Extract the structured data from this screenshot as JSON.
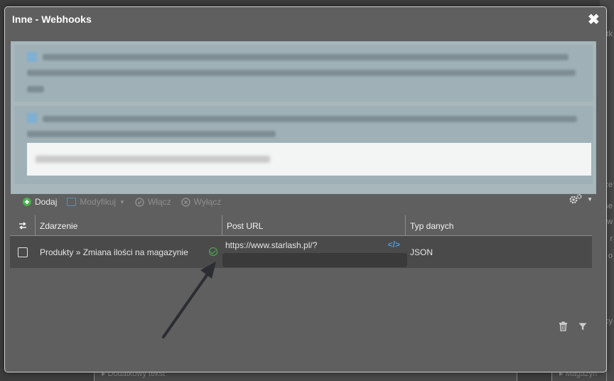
{
  "modal": {
    "title": "Inne - Webhooks"
  },
  "toolbar": {
    "add_label": "Dodaj",
    "modify_label": "Modyfikuj",
    "enable_label": "Włącz",
    "disable_label": "Wyłącz"
  },
  "table": {
    "headers": {
      "event": "Zdarzenie",
      "post_url": "Post URL",
      "data_type": "Typ danych"
    },
    "rows": [
      {
        "event": "Produkty » Zmiana ilości na magazynie",
        "status": "active",
        "post_url": "https://www.starlash.pl/?",
        "data_type": "JSON"
      }
    ]
  },
  "background": {
    "bottom_field_left": "Dodatkowy tekst",
    "bottom_field_right": "Magazyn",
    "right_fragments": [
      "rtk",
      "ze",
      "se",
      "w",
      "r",
      "o",
      "cy"
    ]
  },
  "colors": {
    "modal_bg": "#5f5f5f",
    "row_bg": "#4a4a4a",
    "success": "#4caf50",
    "link_icon": "#4a9be0",
    "info_bg": "#a8b7bb"
  },
  "icons": [
    "close-icon",
    "plus-circle-icon",
    "edit-icon",
    "check-circle-icon",
    "x-circle-icon",
    "gear-icon",
    "swap-icon",
    "code-icon",
    "trash-icon",
    "filter-icon"
  ]
}
